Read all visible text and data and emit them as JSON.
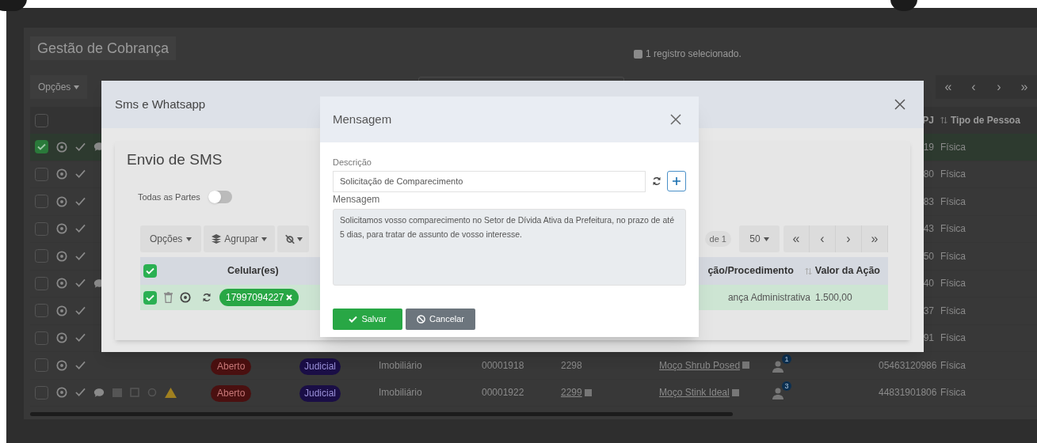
{
  "page": {
    "title": "Gestão de Cobrança",
    "selection_info": "1 registro selecionado.",
    "options_label": "Opções",
    "pager": [
      "«",
      "‹",
      "›",
      "»"
    ]
  },
  "table": {
    "all_selected": false,
    "columns": [
      "PJ",
      "Tipo de Pessoa"
    ],
    "rows": [
      {
        "selected": true,
        "chat": true,
        "cpf": "19",
        "tipo": "Física"
      },
      {
        "selected": false,
        "chat": false,
        "cpf": "80",
        "tipo": "Física"
      },
      {
        "selected": false,
        "chat": false,
        "cpf": "83",
        "tipo": "Física"
      },
      {
        "selected": false,
        "chat": false,
        "cpf": "43",
        "tipo": "Física"
      },
      {
        "selected": false,
        "chat": false,
        "cpf": "50",
        "tipo": "Física"
      },
      {
        "selected": false,
        "chat": true,
        "cpf": "40",
        "tipo": "Física"
      },
      {
        "selected": false,
        "chat": false,
        "cpf": "37",
        "tipo": "Física"
      },
      {
        "selected": false,
        "chat": false,
        "cpf": "91",
        "tipo": "Física"
      },
      {
        "selected": false,
        "chat": false,
        "status": "Aberto",
        "type": "Judicial",
        "category": "Imobiliário",
        "code": "00001918",
        "number": "2298",
        "number_link": false,
        "name": "Moço Shrub Posed",
        "parties": "1",
        "cpf": "05463120986",
        "tipo": "Física"
      },
      {
        "selected": false,
        "chat": true,
        "alerts": true,
        "status": "Aberto",
        "type": "Judicial",
        "category": "Imobiliário",
        "code": "00001922",
        "number": "2299",
        "number_link": true,
        "name": "Moço Stink Ideal",
        "parties": "3",
        "cpf": "44831901806",
        "tipo": "Física"
      }
    ]
  },
  "sms_dialog": {
    "title": "Sms e Whatsapp",
    "section_title": "Envio de SMS",
    "toggle": {
      "label": "Todas as Partes",
      "on": false
    },
    "toolbar": [
      "Opções",
      "Agrupar"
    ],
    "page_info": "de 1",
    "page_size": "50",
    "pager": [
      "«",
      "‹",
      "›",
      "»"
    ],
    "all_selected": true,
    "columns": [
      "Celular(es)",
      "ção/Procedimento",
      "Valor da Ação"
    ],
    "rows": [
      {
        "selected": true,
        "phone": "17997094227",
        "procedure": "ança Administrativa",
        "value": "1.500,00"
      }
    ]
  },
  "message_dialog": {
    "title": "Mensagem",
    "description_label": "Descrição",
    "description": "Solicitação de Comparecimento",
    "message_label": "Mensagem",
    "message": "Solicitamos vosso comparecimento no Setor de Dívida Ativa da Prefeitura, no prazo de até 5 dias, para tratar de assunto de vosso interesse.",
    "buttons": [
      {
        "label": "Salvar",
        "kind": "primary"
      },
      {
        "label": "Cancelar",
        "kind": "secondary"
      }
    ]
  }
}
